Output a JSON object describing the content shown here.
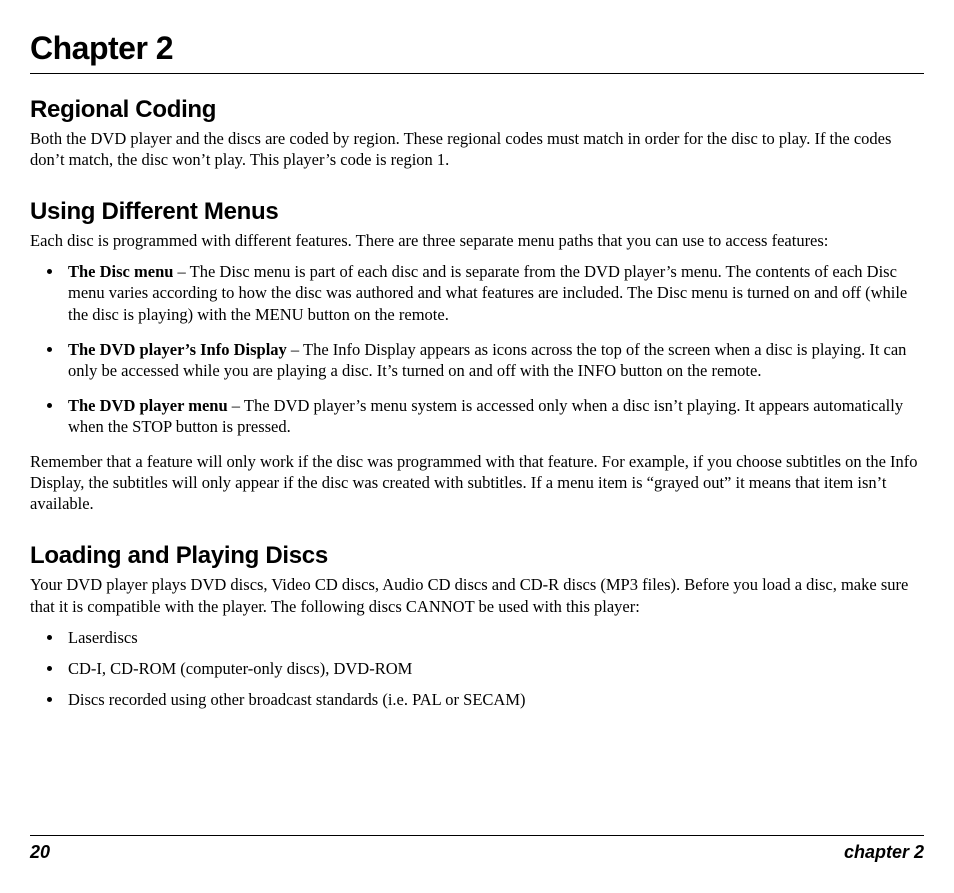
{
  "chapter_title": "Chapter 2",
  "sections": {
    "regional": {
      "heading": "Regional Coding",
      "body": "Both the DVD player and the discs are coded by region. These regional codes must match in order for the disc to play. If the codes don’t match, the disc won’t play. This player’s code is region 1."
    },
    "menus": {
      "heading": "Using Different Menus",
      "intro": "Each disc is programmed with different features. There are three separate menu paths that you can use to access features:",
      "items": [
        {
          "head": "The Disc menu",
          "body": " – The Disc menu is part of each disc and is separate from the DVD player’s menu. The contents of each Disc menu varies according to how the disc was authored and what features are included. The Disc menu is turned on and off (while the disc is playing) with the MENU button on the remote."
        },
        {
          "head": "The DVD player’s Info Display",
          "body": " – The Info Display appears as icons across the top of the screen when a disc is playing. It can only be accessed while you are playing a disc. It’s turned on and off with the INFO button on the remote."
        },
        {
          "head": "The DVD player menu",
          "body": " – The DVD player’s menu system is accessed only when a disc isn’t playing. It appears automatically when the STOP button is pressed."
        }
      ],
      "footnote": "Remember that a feature will only work if the disc was programmed with that feature. For example, if you choose subtitles on the Info Display, the subtitles will only appear if the disc was created with subtitles. If a menu item is “grayed out” it means that item isn’t available."
    },
    "loading": {
      "heading": "Loading and Playing Discs",
      "intro": "Your DVD player plays DVD discs, Video CD discs, Audio CD discs and CD-R discs (MP3 files). Before you load a disc, make sure that it is compatible with the player. The following discs CANNOT be used with this player:",
      "items": [
        "Laserdiscs",
        "CD-I, CD-ROM (computer-only discs), DVD-ROM",
        "Discs recorded using other broadcast standards (i.e. PAL or SECAM)"
      ]
    }
  },
  "footer": {
    "page_number": "20",
    "chapter_ref": "chapter 2"
  }
}
